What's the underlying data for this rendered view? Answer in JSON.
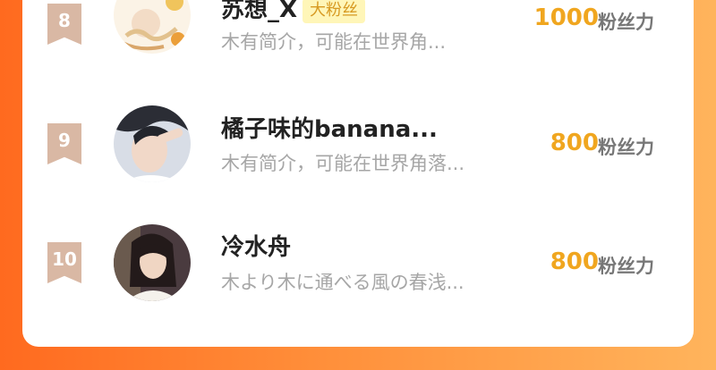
{
  "entries": [
    {
      "rank": "8",
      "name": "苏想_X",
      "badge": "大粉丝",
      "bio": "木有简介，可能在世界角...",
      "fans": "1000",
      "unit": "粉丝力"
    },
    {
      "rank": "9",
      "name": "橘子味的banana...",
      "badge": "",
      "bio": "木有简介，可能在世界角落...",
      "fans": "800",
      "unit": "粉丝力"
    },
    {
      "rank": "10",
      "name": "冷水舟",
      "badge": "",
      "bio": "木より木に通べる風の春浅...",
      "fans": "800",
      "unit": "粉丝力"
    }
  ],
  "colors": {
    "rank_ribbon": "#d9b8a4",
    "fans_count": "#f0a61f",
    "badge_bg": "#fff6b8",
    "background_gradient_start": "#ff6a1f",
    "background_gradient_end": "#ffb45c"
  }
}
